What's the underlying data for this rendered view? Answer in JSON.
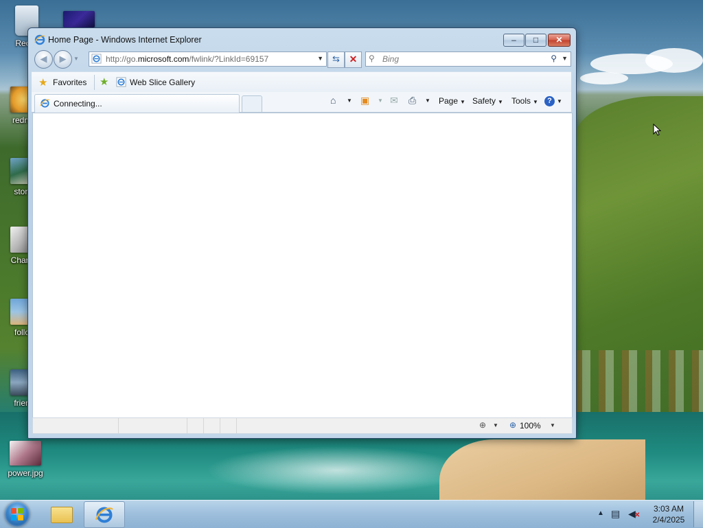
{
  "desktop": {
    "icons": [
      {
        "label": "Recyc"
      },
      {
        "label": "redmo"
      },
      {
        "label": "stone"
      },
      {
        "label": "Charac"
      },
      {
        "label": "follov"
      },
      {
        "label": "frienc"
      },
      {
        "label": "power.jpg"
      }
    ]
  },
  "window": {
    "title": "Home Page - Windows Internet Explorer",
    "controls": {
      "minimize": "–",
      "maximize": "□",
      "close": "✕"
    }
  },
  "address_bar": {
    "url_prefix": "http://go.",
    "url_domain": "microsoft.com",
    "url_suffix": "/fwlink/?LinkId=69157"
  },
  "search": {
    "placeholder": "Bing"
  },
  "favorites_bar": {
    "favorites_label": "Favorites",
    "web_slice_gallery_label": "Web Slice Gallery"
  },
  "tabs": [
    {
      "label": "Connecting..."
    }
  ],
  "command_bar": {
    "page_label": "Page",
    "safety_label": "Safety",
    "tools_label": "Tools",
    "help_glyph": "?"
  },
  "status_bar": {
    "zoom": "100%"
  },
  "taskbar": {
    "clock_time": "3:03 AM",
    "clock_date": "2/4/2025"
  },
  "colors": {
    "title_bar": "#c9dced",
    "close_button": "#c2412d",
    "taskbar": "#9fc0dd",
    "accent_blue": "#2b62a7"
  }
}
